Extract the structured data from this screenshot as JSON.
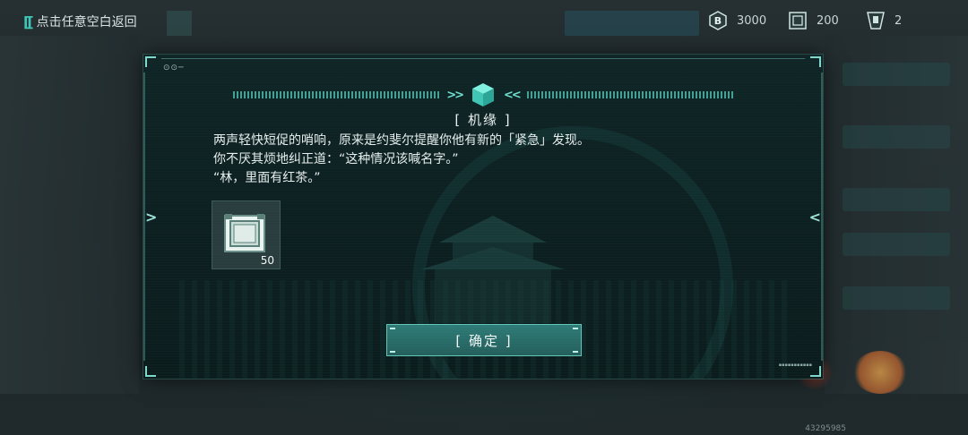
{
  "topbar": {
    "back_label": "点击任意空白返回",
    "back_bracket": "[[",
    "resources": [
      {
        "icon": "currency-b-icon",
        "value": "3000"
      },
      {
        "icon": "supply-crate-icon",
        "value": "200"
      },
      {
        "icon": "badge-ticket-icon",
        "value": "2"
      }
    ]
  },
  "dialog": {
    "decor_dots": "⊙⊙─",
    "header_icon": "cube-icon",
    "title": "[ 机缘 ]",
    "lines": [
      "两声轻快短促的哨响，原来是约斐尔提醒你他有新的「紧急」发现。",
      "你不厌其烦地纠正道：“这种情况该喊名字。”",
      "“林，里面有红茶。”"
    ],
    "reward": {
      "icon": "supply-crate-icon",
      "count": "50"
    },
    "confirm_label": "[ 确定 ]"
  },
  "footer": {
    "uid": "43295985"
  },
  "colors": {
    "accent": "#3fc6b5",
    "button": "#2e7b77",
    "panel": "#0f2526"
  }
}
